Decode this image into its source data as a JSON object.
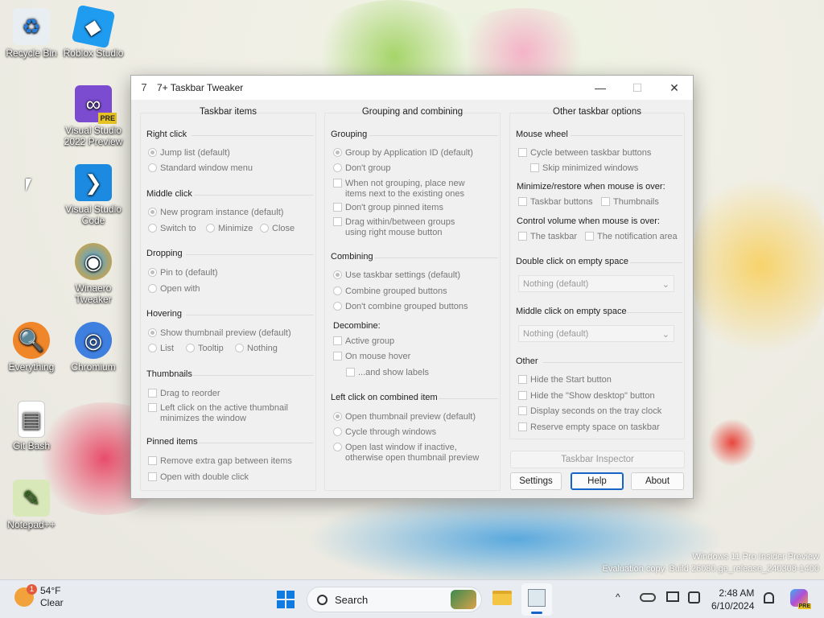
{
  "desktop": {
    "icons": [
      {
        "label": "Recycle Bin",
        "glyph": "♻"
      },
      {
        "label": "Roblox Studio",
        "glyph": "◆"
      },
      {
        "label": "Visual Studio 2022 Preview",
        "glyph": "∞",
        "badge": "PRE"
      },
      {
        "label": "Visual Studio Code",
        "glyph": "❯"
      },
      {
        "label": "Winaero Tweaker",
        "glyph": "◉"
      },
      {
        "label": "Everything",
        "glyph": "🔍"
      },
      {
        "label": "Chromium",
        "glyph": "◎"
      },
      {
        "label": "Git Bash",
        "glyph": "▤"
      },
      {
        "label": "Notepad++",
        "glyph": "✎"
      }
    ],
    "shortcut_glyph": "↗",
    "watermark_line1": "Windows 11 Pro Insider Preview",
    "watermark_line2": "Evaluation copy. Build 26080.ge_release_240308-1400"
  },
  "window": {
    "title": "7+ Taskbar Tweaker",
    "controls": {
      "minimize": "—",
      "maximize": "☐",
      "close": "✕"
    },
    "col1": {
      "heading": "Taskbar items",
      "right_click": {
        "title": "Right click",
        "jump": "Jump list (default)",
        "standard": "Standard window menu"
      },
      "middle_click": {
        "title": "Middle click",
        "new": "New program instance (default)",
        "switch": "Switch to",
        "minimize": "Minimize",
        "close": "Close"
      },
      "dropping": {
        "title": "Dropping",
        "pin": "Pin to (default)",
        "open": "Open with"
      },
      "hovering": {
        "title": "Hovering",
        "thumb": "Show thumbnail preview (default)",
        "list": "List",
        "tooltip": "Tooltip",
        "nothing": "Nothing"
      },
      "thumbnails": {
        "title": "Thumbnails",
        "drag": "Drag to reorder",
        "left1": "Left click on the active thumbnail",
        "left2": "minimizes the window"
      },
      "pinned": {
        "title": "Pinned items",
        "gap": "Remove extra gap between items",
        "dbl": "Open with double click"
      }
    },
    "col2": {
      "heading": "Grouping and combining",
      "grouping": {
        "title": "Grouping",
        "appid": "Group by Application ID (default)",
        "dont": "Don't group",
        "place1": "When not grouping, place new",
        "place2": "items next to the existing ones",
        "pinned": "Don't group pinned items",
        "drag1": "Drag within/between groups",
        "drag2": "using right mouse button"
      },
      "combining": {
        "title": "Combining",
        "use": "Use taskbar settings (default)",
        "combine": "Combine grouped buttons",
        "dont": "Don't combine grouped buttons"
      },
      "decombine": {
        "title": "Decombine:",
        "active": "Active group",
        "hover": "On mouse hover",
        "labels": "...and show labels"
      },
      "leftclick": {
        "title": "Left click on combined item",
        "open": "Open thumbnail preview (default)",
        "cycle": "Cycle through windows",
        "last1": "Open last window if inactive,",
        "last2": "otherwise open thumbnail preview"
      }
    },
    "col3": {
      "heading": "Other taskbar options",
      "wheel": {
        "title": "Mouse wheel",
        "cycle": "Cycle between taskbar buttons",
        "skip": "Skip minimized windows"
      },
      "minrestore": {
        "title": "Minimize/restore when mouse is over:",
        "buttons": "Taskbar buttons",
        "thumbs": "Thumbnails"
      },
      "volume": {
        "title": "Control volume when mouse is over:",
        "taskbar": "The taskbar",
        "notif": "The notification area"
      },
      "dblclick": {
        "title": "Double click on empty space",
        "value": "Nothing (default)"
      },
      "midclick": {
        "title": "Middle click on empty space",
        "value": "Nothing (default)"
      },
      "other": {
        "title": "Other",
        "start": "Hide the Start button",
        "showdesk": "Hide the \"Show desktop\" button",
        "seconds": "Display seconds on the tray clock",
        "reserve": "Reserve empty space on taskbar"
      },
      "inspector": "Taskbar Inspector",
      "settings": "Settings",
      "help": "Help",
      "about": "About"
    },
    "chevron": "⌄"
  },
  "taskbar": {
    "weather_temp": "54°F",
    "weather_cond": "Clear",
    "weather_badge": "1",
    "search": "Search",
    "time": "2:48 AM",
    "date": "6/10/2024",
    "tray_icons": [
      "chevron-up",
      "onedrive",
      "display",
      "network",
      "bell"
    ],
    "copilot_badge": "PRE"
  },
  "colors": {
    "accent": "#1664c8",
    "window_bg": "#f0f0f0",
    "taskbar_bg": "#e8ecf1"
  }
}
